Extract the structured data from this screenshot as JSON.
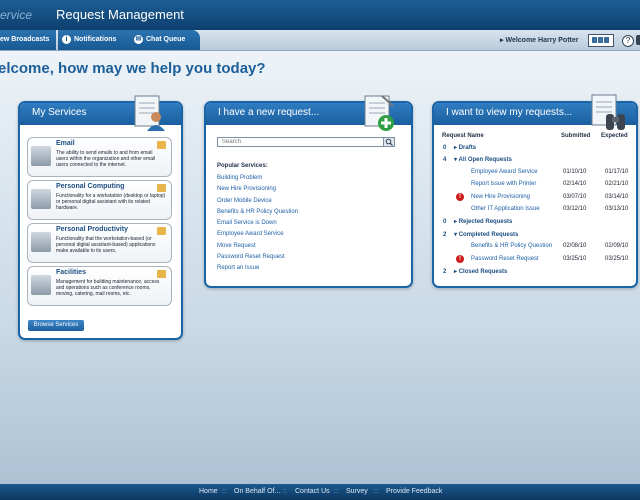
{
  "app": {
    "title_prefix": "ervice",
    "title_main": "Request Management"
  },
  "nav": {
    "tabs": [
      {
        "label": "ew Broadcasts",
        "icon": "broadcast-icon"
      },
      {
        "label": "Notifications",
        "icon": "info-icon"
      },
      {
        "label": "Chat Queue",
        "icon": "chat-icon"
      }
    ],
    "welcome": "Welcome Harry Potter",
    "help_label": "?"
  },
  "greeting": "elcome, how may we help you today?",
  "my_services": {
    "title": "My Services",
    "items": [
      {
        "name": "Email",
        "description": "The ability to send emails to and from email users within the organization and other email users connected to the internet."
      },
      {
        "name": "Personal Computing",
        "description": "Functionality for a workstation (desktop or laptop) or personal digital assistant with its related hardware."
      },
      {
        "name": "Personal Productivity",
        "description": "Functionality that the workstation-based (or personal digital assistant-based) applications make available to its users."
      },
      {
        "name": "Facilities",
        "description": "Management for building maintenance, access and operations such as conference rooms, moving, catering, mail rooms, etc."
      }
    ],
    "browse_label": "Browse Services"
  },
  "new_request": {
    "title": "I have a new request...",
    "search_placeholder": "Search",
    "popular_title": "Popular Services:",
    "links": [
      "Building Problem",
      "New Hire Provisioning",
      "Order Mobile Device",
      "Benefits & HR Policy Question",
      "Email Service is Down",
      "Employee Award Service",
      "Move Request",
      "Password Reset Request",
      "Report an Issue"
    ]
  },
  "view_requests": {
    "title": "I want to view my requests...",
    "headers": {
      "name": "Request Name",
      "submitted": "Submitted",
      "expected": "Expected"
    },
    "sections": {
      "drafts": {
        "count": "0",
        "label": "Drafts"
      },
      "open": {
        "count": "4",
        "label": "All Open Requests"
      },
      "rejected": {
        "count": "0",
        "label": "Rejected Requests"
      },
      "completed": {
        "count": "2",
        "label": "Completed Requests"
      },
      "closed": {
        "count": "2",
        "label": "Closed Requests"
      }
    },
    "open_rows": [
      {
        "name": "Employee Award Service",
        "submitted": "01/10/10",
        "expected": "01/17/10",
        "alert": false
      },
      {
        "name": "Report issue with Printer",
        "submitted": "02/14/10",
        "expected": "02/21/10",
        "alert": false
      },
      {
        "name": "New Hire Provisioning",
        "submitted": "03/07/10",
        "expected": "03/14/10",
        "alert": true
      },
      {
        "name": "Other IT Application Issue",
        "submitted": "03/12/10",
        "expected": "03/13/10",
        "alert": false
      }
    ],
    "completed_rows": [
      {
        "name": "Benefits & HR Policy Question",
        "submitted": "02/08/10",
        "expected": "02/09/10",
        "alert": false
      },
      {
        "name": "Password Reset Request",
        "submitted": "03/25/10",
        "expected": "03/25/10",
        "alert": true
      }
    ]
  },
  "footer": {
    "links": [
      "Home",
      "On Behalf Of...",
      "Contact Us",
      "Survey",
      "Provide Feedback"
    ],
    "separator": "::"
  }
}
